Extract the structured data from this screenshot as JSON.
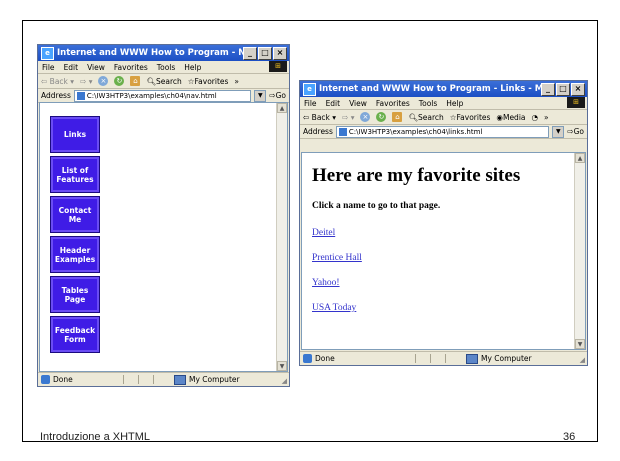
{
  "slide": {
    "footer_left": "Introduzione a XHTML",
    "footer_right": "36"
  },
  "nav_window": {
    "title": "Internet and WWW How to Program - Navigatio...",
    "menu": [
      "File",
      "Edit",
      "View",
      "Favorites",
      "Tools",
      "Help"
    ],
    "toolbar": {
      "back": "Back",
      "search": "Search",
      "favorites": "Favorites"
    },
    "address_label": "Address",
    "address": "C:\\IW3HTP3\\examples\\ch04\\nav.html",
    "go": "Go",
    "buttons": [
      {
        "line1": "Links",
        "line2": ""
      },
      {
        "line1": "List of",
        "line2": "Features"
      },
      {
        "line1": "Contact",
        "line2": "Me"
      },
      {
        "line1": "Header",
        "line2": "Examples"
      },
      {
        "line1": "Tables",
        "line2": "Page"
      },
      {
        "line1": "Feedback",
        "line2": "Form"
      }
    ],
    "status_done": "Done",
    "status_zone": "My Computer"
  },
  "links_window": {
    "title": "Internet and WWW How to Program - Links - Microsoft Inter...",
    "menu": [
      "File",
      "Edit",
      "View",
      "Favorites",
      "Tools",
      "Help"
    ],
    "toolbar": {
      "back": "Back",
      "search": "Search",
      "favorites": "Favorites",
      "media": "Media"
    },
    "address_label": "Address",
    "address": "C:\\IW3HTP3\\examples\\ch04\\links.html",
    "go": "Go",
    "heading": "Here are my favorite sites",
    "subheading": "Click a name to go to that page.",
    "links": [
      "Deitel",
      "Prentice Hall",
      "Yahoo!",
      "USA Today"
    ],
    "status_done": "Done",
    "status_zone": "My Computer"
  }
}
